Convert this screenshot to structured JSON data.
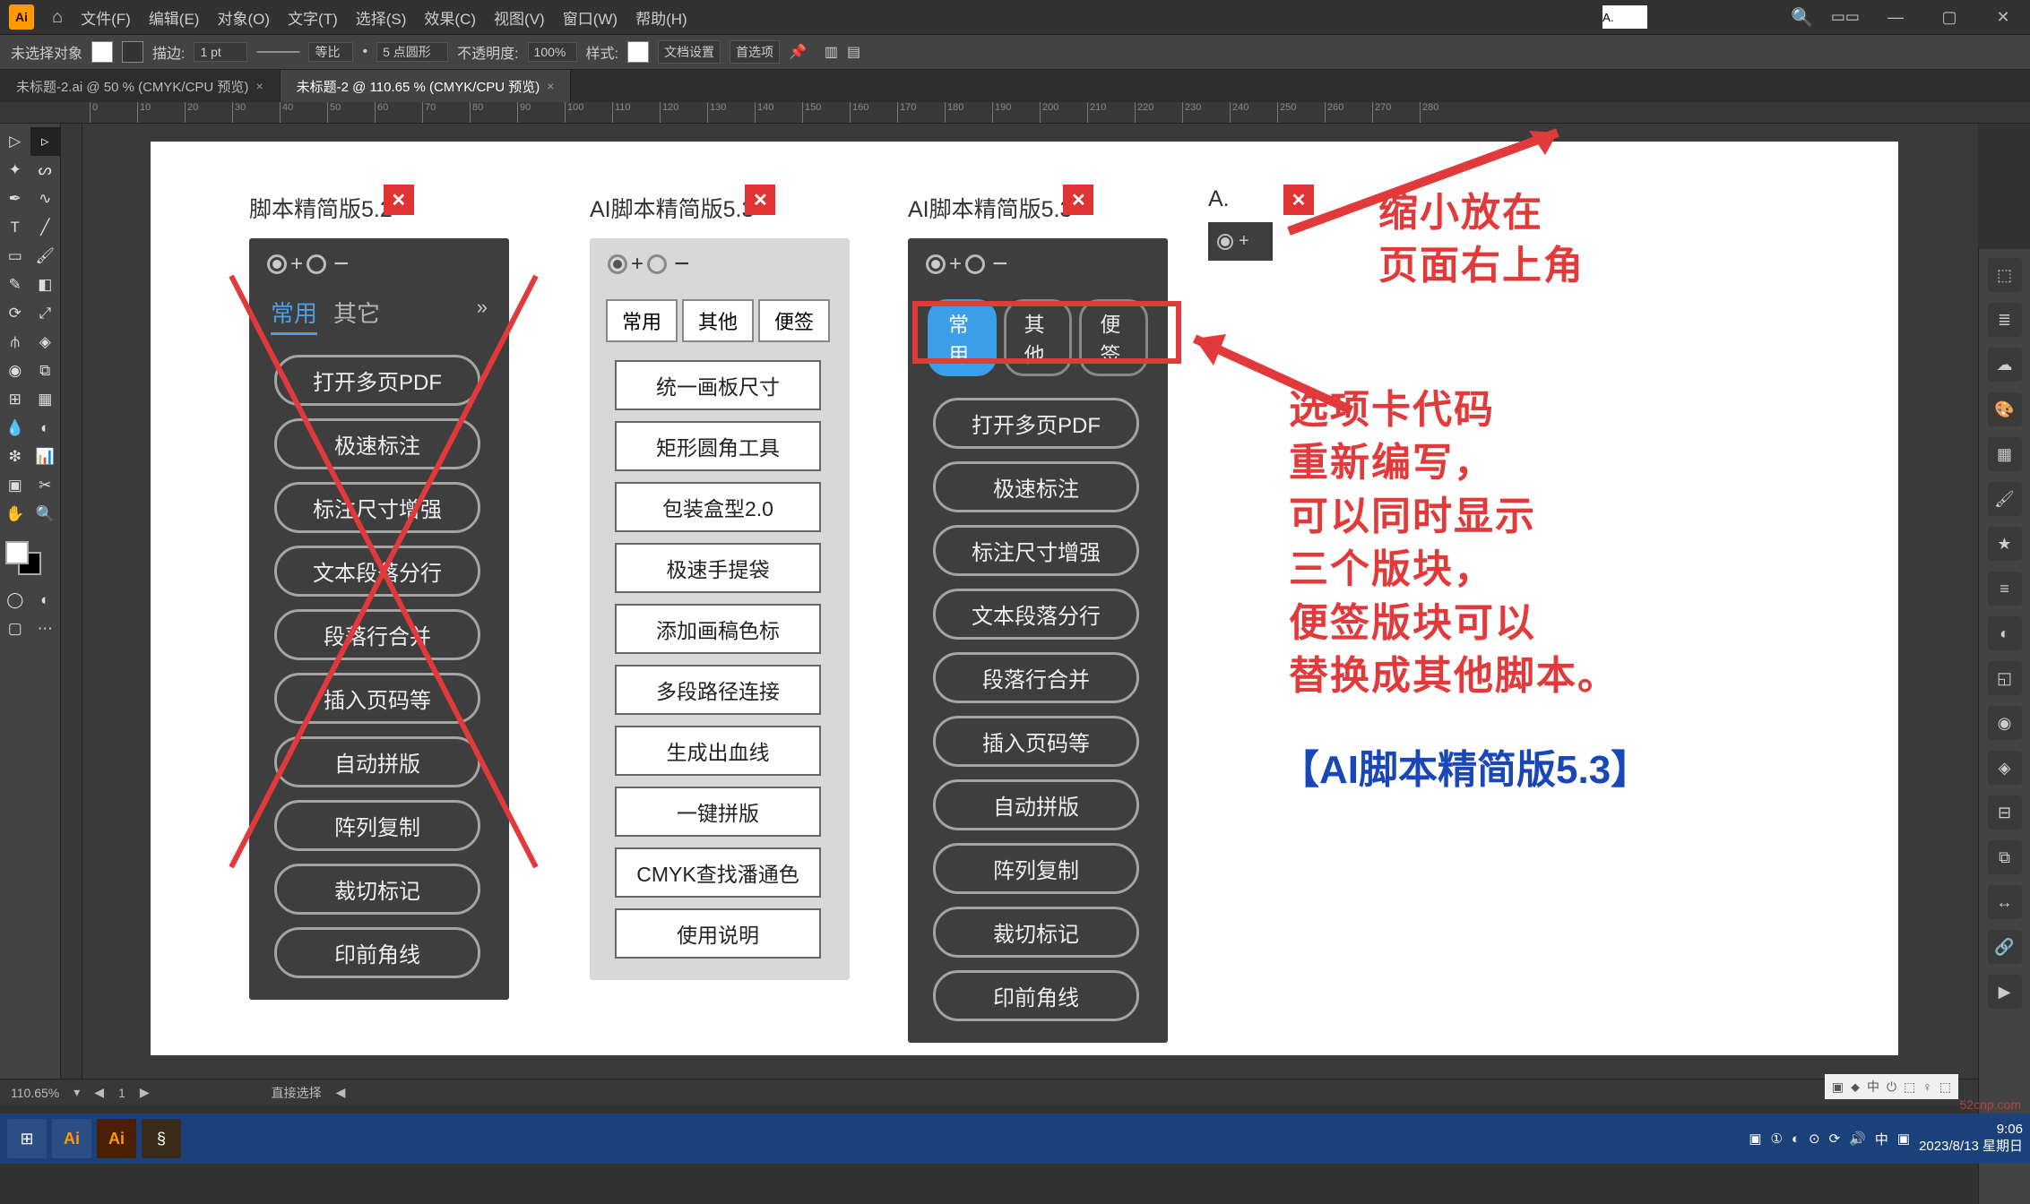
{
  "menubar": {
    "items": [
      "文件(F)",
      "编辑(E)",
      "对象(O)",
      "文字(T)",
      "选择(S)",
      "效果(C)",
      "视图(V)",
      "窗口(W)",
      "帮助(H)"
    ],
    "top_input": "A."
  },
  "optionsbar": {
    "no_selection": "未选择对象",
    "stroke_label": "描边:",
    "stroke_val": "1 pt",
    "uniform": "等比",
    "points": "5 点圆形",
    "opacity_label": "不透明度:",
    "opacity_val": "100%",
    "style_label": "样式:",
    "doc_settings": "文档设置",
    "prefs": "首选项"
  },
  "doctabs": [
    {
      "label": "未标题-2.ai @ 50 % (CMYK/CPU 预览)",
      "active": false
    },
    {
      "label": "未标题-2 @ 110.65 % (CMYK/CPU 预览)",
      "active": true
    }
  ],
  "ruler_marks": [
    "0",
    "10",
    "20",
    "30",
    "40",
    "50",
    "60",
    "70",
    "80",
    "90",
    "100",
    "110",
    "120",
    "130",
    "140",
    "150",
    "160",
    "170",
    "180",
    "190",
    "200",
    "210",
    "220",
    "230",
    "240",
    "250",
    "260",
    "270",
    "280"
  ],
  "panels": {
    "v52": {
      "title": "脚本精简版5.2",
      "tabs": [
        "常用",
        "其它"
      ],
      "buttons": [
        "打开多页PDF",
        "极速标注",
        "标注尺寸增强",
        "文本段落分行",
        "段落行合并",
        "插入页码等",
        "自动拼版",
        "阵列复制",
        "裁切标记",
        "印前角线"
      ]
    },
    "v53_light": {
      "title": "AI脚本精简版5.3",
      "tabs": [
        "常用",
        "其他",
        "便签"
      ],
      "buttons": [
        "统一画板尺寸",
        "矩形圆角工具",
        "包装盒型2.0",
        "极速手提袋",
        "添加画稿色标",
        "多段路径连接",
        "生成出血线",
        "一键拼版",
        "CMYK查找潘通色",
        "使用说明"
      ]
    },
    "v53_dark": {
      "title": "AI脚本精简版5.3",
      "tabs": [
        "常用",
        "其他",
        "便签"
      ],
      "buttons": [
        "打开多页PDF",
        "极速标注",
        "标注尺寸增强",
        "文本段落分行",
        "段落行合并",
        "插入页码等",
        "自动拼版",
        "阵列复制",
        "裁切标记",
        "印前角线"
      ]
    },
    "mini": {
      "title": "A."
    }
  },
  "annotations": {
    "top": "缩小放在\n页面右上角",
    "body": "选项卡代码\n重新编写，\n可以同时显示\n三个版块，\n便签版块可以\n替换成其他脚本。",
    "final": "【AI脚本精简版5.3】"
  },
  "statusbar": {
    "zoom": "110.65%",
    "tool": "直接选择"
  },
  "bottom_info": [
    "▣",
    "⬥",
    "中",
    "⏻",
    "⬚",
    "♀",
    "⬚"
  ],
  "watermark": "52cnp.com",
  "taskbar": {
    "time": "9:06",
    "date": "2023/8/13 星期日",
    "tray": [
      "▣",
      "①",
      "◐",
      "⊙",
      "⟳",
      "🔊",
      "中",
      "▣"
    ]
  }
}
